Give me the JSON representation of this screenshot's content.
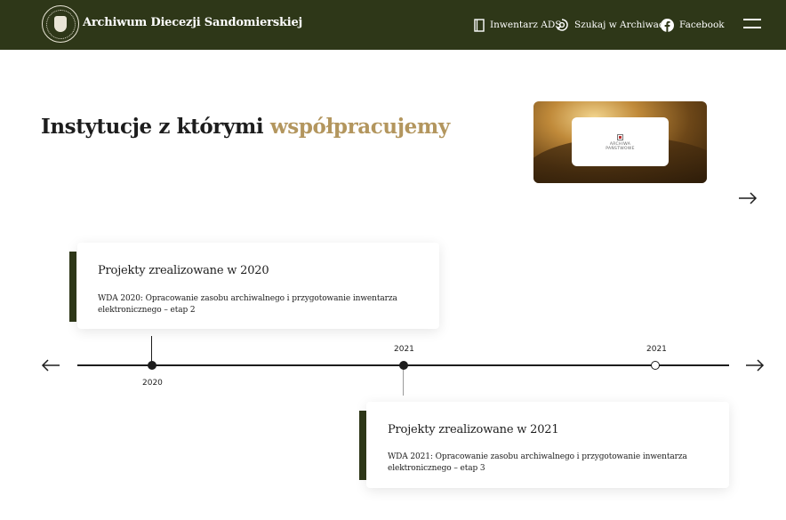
{
  "header": {
    "brand": "Archiwum Diecezji Sandomierskiej",
    "nav": [
      {
        "label": "Inwentarz ADS",
        "icon": "book-icon"
      },
      {
        "label": "Szukaj w Archiwach",
        "icon": "search-archive-icon"
      },
      {
        "label": "Facebook",
        "icon": "facebook-icon"
      }
    ],
    "menu_icon": "hamburger-menu-icon"
  },
  "hero": {
    "title_main": "Instytucje z którymi",
    "title_accent": "współpracujemy"
  },
  "partners": [
    {
      "logo_lines": [
        "ARCHIWA",
        "PAŃSTWOWE"
      ]
    }
  ],
  "timeline": {
    "points": [
      {
        "year": "2020",
        "filled": true
      },
      {
        "year": "2021",
        "filled": true
      },
      {
        "year": "2021",
        "filled": false
      }
    ],
    "cards": [
      {
        "title": "Projekty zrealizowane w 2020",
        "text": "WDA 2020: Opracowanie zasobu archiwalnego i przygotowanie inwentarza elektronicznego – etap 2"
      },
      {
        "title": "Projekty zrealizowane w 2021",
        "text": "WDA 2021: Opracowanie zasobu archiwalnego i przygotowanie inwentarza elektronicznego – etap 3"
      }
    ]
  },
  "colors": {
    "header_bg": "#2e3718",
    "accent": "#b3965e",
    "text": "#1d1d1d"
  }
}
